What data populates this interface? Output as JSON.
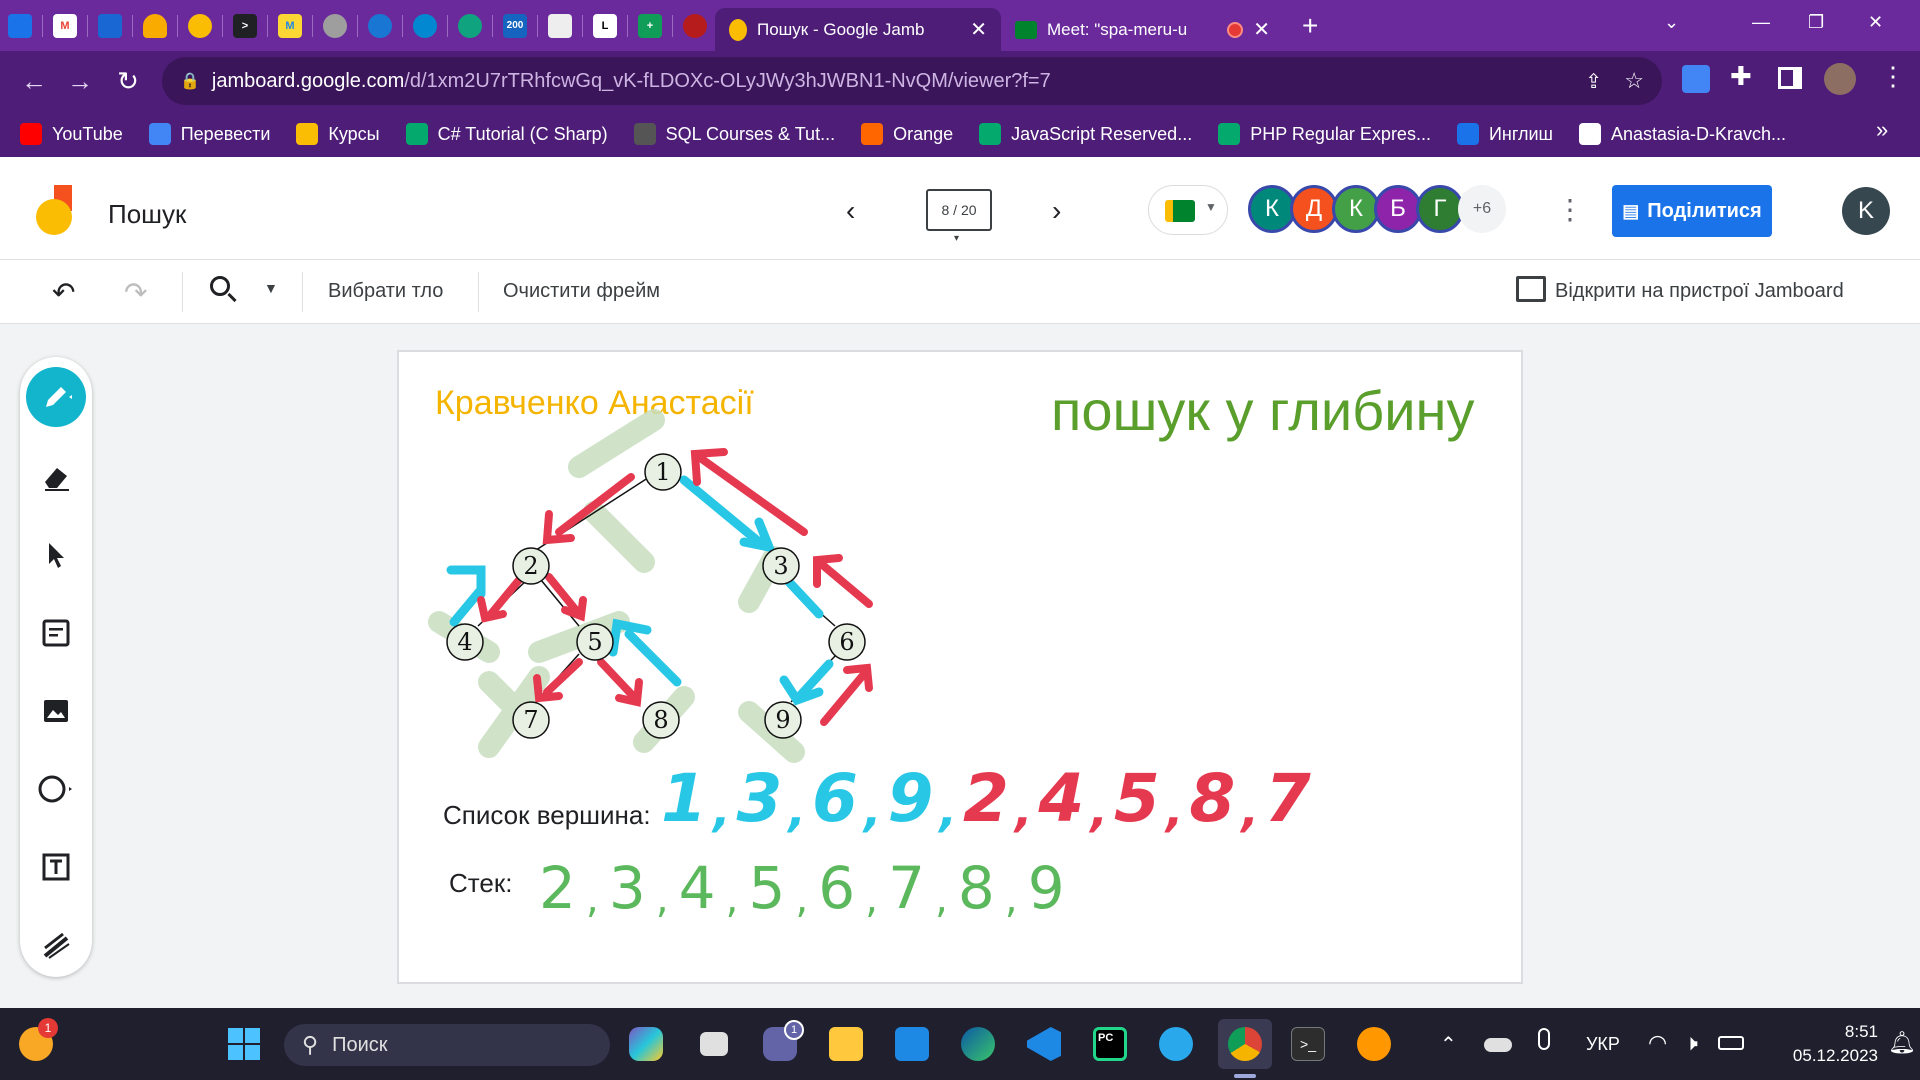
{
  "browser": {
    "active_tab_title": "Пошук - Google Jamb",
    "inactive_tab_title": "Meet: \"spa-meru-u",
    "url_host": "jamboard.google.com",
    "url_path": "/d/1xm2U7rTRhfcwGq_vK-fLDOXc-OLyJWy3hJWBN1-NvQM/viewer?f=7",
    "pinned_badge_200": "200"
  },
  "bookmarks": [
    {
      "label": "YouTube",
      "icon": "youtube-icon",
      "color": "#ff0000"
    },
    {
      "label": "Перевести",
      "icon": "translate-icon",
      "color": "#4285f4"
    },
    {
      "label": "Курсы",
      "icon": "classroom-icon",
      "color": "#fbbc04"
    },
    {
      "label": "C# Tutorial (C Sharp)",
      "icon": "w3-icon",
      "color": "#04aa6d"
    },
    {
      "label": "SQL Courses & Tut...",
      "icon": "sql-icon",
      "color": "#555555"
    },
    {
      "label": "Orange",
      "icon": "orange-icon",
      "color": "#ff6600"
    },
    {
      "label": "JavaScript Reserved...",
      "icon": "w3-icon",
      "color": "#04aa6d"
    },
    {
      "label": "PHP Regular Expres...",
      "icon": "w3-icon",
      "color": "#04aa6d"
    },
    {
      "label": "Инглиш",
      "icon": "cloud-icon",
      "color": "#1a73e8"
    },
    {
      "label": "Anastasia-D-Kravch...",
      "icon": "github-icon",
      "color": "#ffffff"
    }
  ],
  "bookmarks_more": "»",
  "app": {
    "doc_title": "Пошук",
    "frame_counter": "8 / 20",
    "collaborators": [
      {
        "letter": "К",
        "color": "#00897b"
      },
      {
        "letter": "Д",
        "color": "#f4511e"
      },
      {
        "letter": "К",
        "color": "#43a047"
      },
      {
        "letter": "Б",
        "color": "#8e24aa"
      },
      {
        "letter": "Г",
        "color": "#2e7d32"
      }
    ],
    "more_collaborators": "+6",
    "share_label": "Поділитися",
    "user_initial": "K"
  },
  "toolbar": {
    "background_label": "Вибрати тло",
    "clear_label": "Очистити фрейм",
    "open_device_label": "Відкрити на пристрої Jamboard"
  },
  "frame": {
    "author": "Кравченко Анастасії",
    "heading": "пошук у глибину",
    "list_label": "Список вершина:",
    "stack_label": "Стек:",
    "nodes": [
      "1",
      "2",
      "3",
      "4",
      "5",
      "6",
      "7",
      "8",
      "9"
    ],
    "list_sequence_blue": [
      "1",
      ",",
      "3",
      ",",
      "6",
      ",",
      "9",
      ","
    ],
    "list_sequence_red": [
      "2",
      ",",
      "4",
      ",",
      "5",
      ",",
      "8",
      ",",
      "7"
    ],
    "stack_sequence": [
      "2",
      ",",
      "3",
      ",",
      "4",
      ",",
      "5",
      ",",
      "6",
      ",",
      "7",
      ",",
      "8",
      ",",
      "9"
    ]
  },
  "taskbar": {
    "search_placeholder": "Поиск",
    "language": "УКР",
    "time": "8:51",
    "date": "05.12.2023",
    "weather_badge": "1",
    "teams_badge": "1"
  }
}
